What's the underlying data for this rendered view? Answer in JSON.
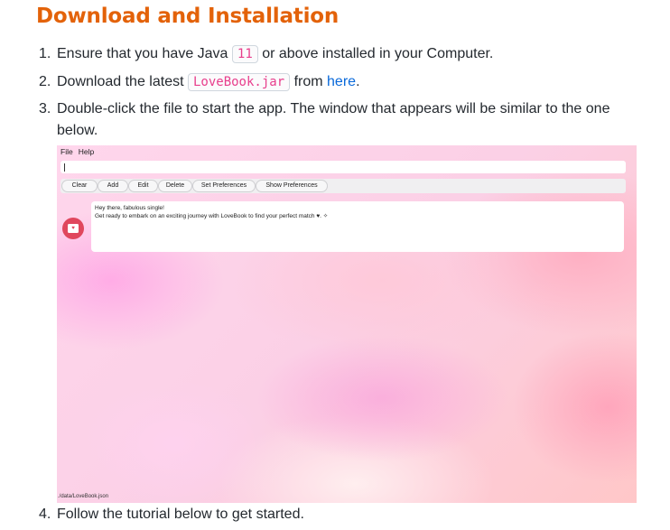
{
  "heading": "Download and Installation",
  "steps": {
    "s1": {
      "num": "1.",
      "before": "Ensure that you have Java ",
      "code": "11",
      "after": " or above installed in your Computer."
    },
    "s2": {
      "num": "2.",
      "before": "Download the latest ",
      "code": "LoveBook.jar",
      "middle": " from ",
      "link": "here",
      "after": "."
    },
    "s3": {
      "num": "3.",
      "text": "Double-click the file to start the app. The window that appears will be similar to the one below."
    },
    "s4": {
      "num": "4.",
      "text": "Follow the tutorial below to get started."
    }
  },
  "app": {
    "menu": [
      "File",
      "Help"
    ],
    "command_value": "",
    "buttons": [
      "Clear",
      "Add",
      "Edit",
      "Delete",
      "Set Preferences",
      "Show Preferences"
    ],
    "avatar_icon": "heart-envelope-icon",
    "message_line1": "Hey there, fabulous single!",
    "message_line2": "Get ready to embark on an exciting journey with LoveBook to find your perfect match ♥. ✧",
    "status": "./data/LoveBook.json"
  },
  "colors": {
    "heading": "#e36209",
    "link": "#0969da",
    "code": "#e83e8c",
    "avatar": "#e0475d"
  }
}
